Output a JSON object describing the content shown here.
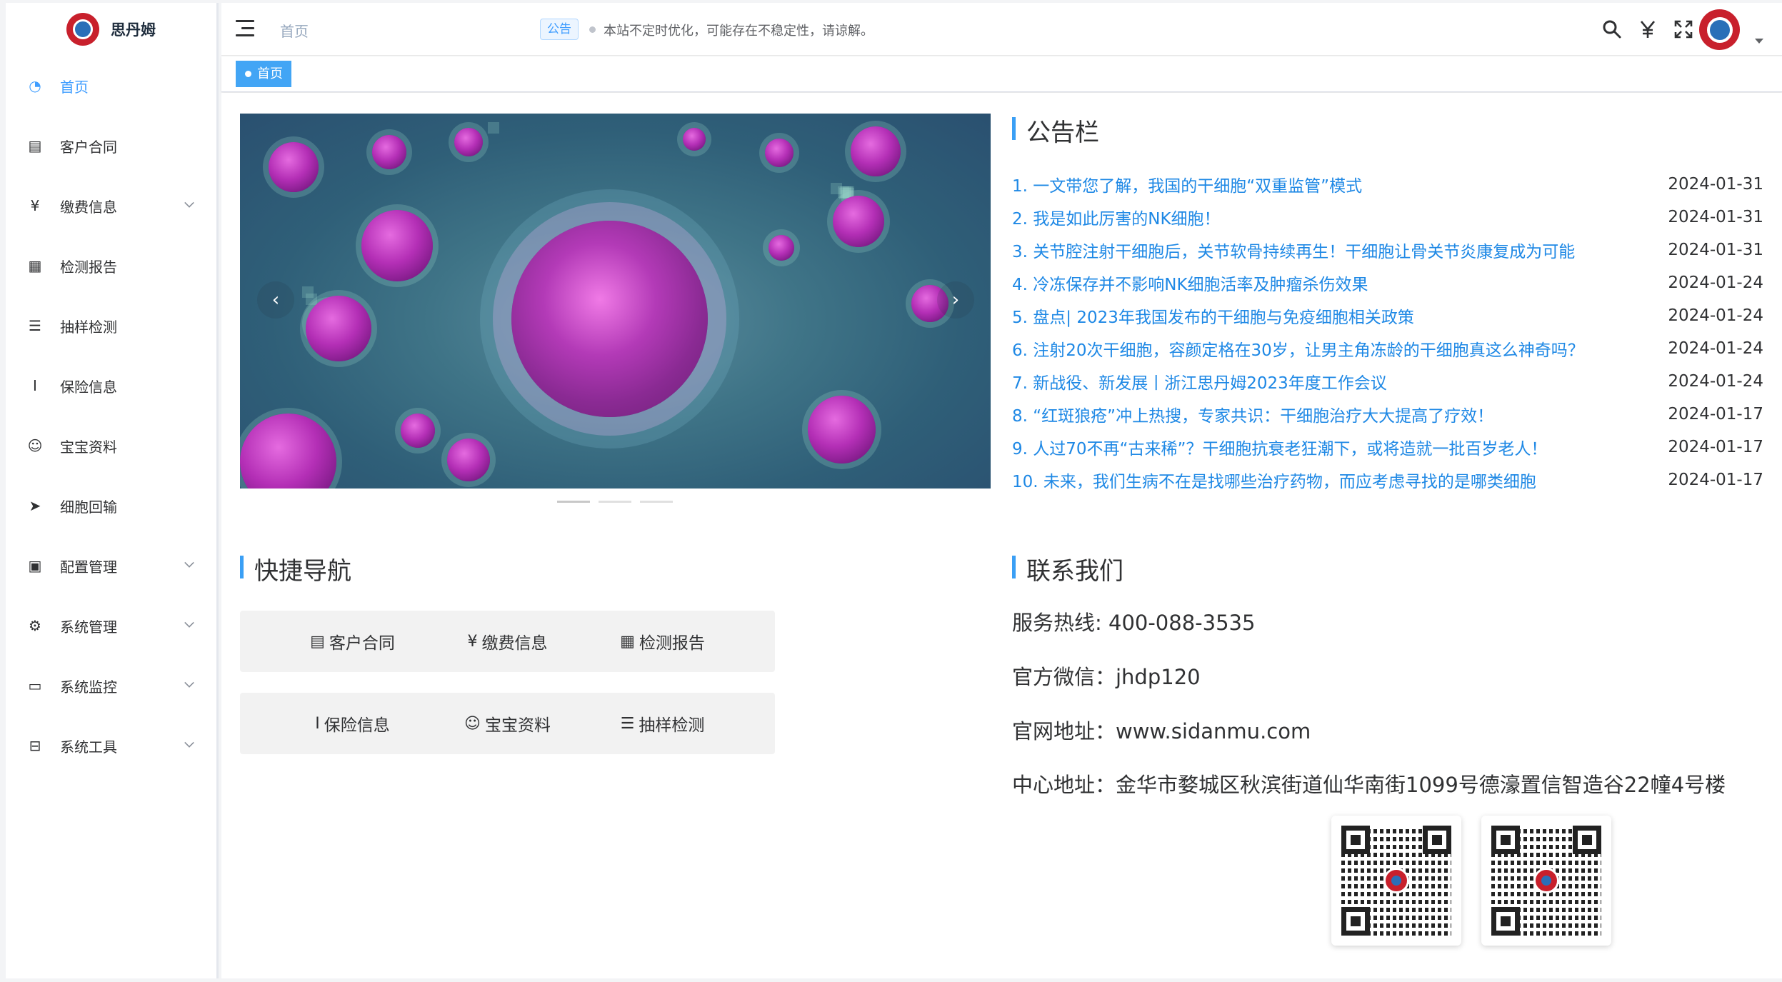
{
  "app": {
    "name": "思丹姆"
  },
  "sidebar": {
    "items": [
      {
        "label": "首页",
        "icon": "dashboard-icon",
        "glyph": "◔",
        "active": true,
        "expandable": false
      },
      {
        "label": "客户合同",
        "icon": "contract-icon",
        "glyph": "▤",
        "active": false,
        "expandable": false
      },
      {
        "label": "缴费信息",
        "icon": "yen-icon",
        "glyph": "¥",
        "active": false,
        "expandable": true
      },
      {
        "label": "检测报告",
        "icon": "report-icon",
        "glyph": "▦",
        "active": false,
        "expandable": false
      },
      {
        "label": "抽样检测",
        "icon": "list-icon",
        "glyph": "☰",
        "active": false,
        "expandable": false
      },
      {
        "label": "保险信息",
        "icon": "insurance-icon",
        "glyph": "I",
        "active": false,
        "expandable": false
      },
      {
        "label": "宝宝资料",
        "icon": "baby-icon",
        "glyph": "☺",
        "active": false,
        "expandable": false
      },
      {
        "label": "细胞回输",
        "icon": "send-icon",
        "glyph": "➤",
        "active": false,
        "expandable": false
      },
      {
        "label": "配置管理",
        "icon": "config-icon",
        "glyph": "▣",
        "active": false,
        "expandable": true
      },
      {
        "label": "系统管理",
        "icon": "gear-icon",
        "glyph": "⚙",
        "active": false,
        "expandable": true
      },
      {
        "label": "系统监控",
        "icon": "monitor-icon",
        "glyph": "▭",
        "active": false,
        "expandable": true
      },
      {
        "label": "系统工具",
        "icon": "tool-icon",
        "glyph": "⊟",
        "active": false,
        "expandable": true
      }
    ]
  },
  "header": {
    "breadcrumb": "首页",
    "notice_badge": "公告",
    "notice_text": "本站不定时优化，可能存在不稳定性，请谅解。",
    "icons": [
      "search-icon",
      "yen-icon",
      "fullscreen-icon"
    ]
  },
  "tags": {
    "active": "首页"
  },
  "announcements": {
    "title": "公告栏",
    "items": [
      {
        "title": "1. 一文带您了解，我国的干细胞“双重监管”模式",
        "date": "2024-01-31"
      },
      {
        "title": "2. 我是如此厉害的NK细胞！",
        "date": "2024-01-31"
      },
      {
        "title": "3. 关节腔注射干细胞后，关节软骨持续再生！干细胞让骨关节炎康复成为可能",
        "date": "2024-01-31"
      },
      {
        "title": "4. 冷冻保存并不影响NK细胞活率及肿瘤杀伤效果",
        "date": "2024-01-24"
      },
      {
        "title": "5. 盘点| 2023年我国发布的干细胞与免疫细胞相关政策",
        "date": "2024-01-24"
      },
      {
        "title": "6. 注射20次干细胞，容颜定格在30岁，让男主角冻龄的干细胞真这么神奇吗？",
        "date": "2024-01-24"
      },
      {
        "title": "7. 新战役、新发展丨浙江思丹姆2023年度工作会议",
        "date": "2024-01-24"
      },
      {
        "title": "8. “红斑狼疮”冲上热搜，专家共识：干细胞治疗大大提高了疗效！",
        "date": "2024-01-17"
      },
      {
        "title": "9. 人过70不再“古来稀”？干细胞抗衰老狂潮下，或将造就一批百岁老人！",
        "date": "2024-01-17"
      },
      {
        "title": "10. 未来，我们生病不在是找哪些治疗药物，而应考虑寻找的是哪类细胞",
        "date": "2024-01-17"
      }
    ]
  },
  "quicknav": {
    "title": "快捷导航",
    "buttons": [
      {
        "label": "客户合同",
        "icon": "contract-icon",
        "glyph": "▤"
      },
      {
        "label": "缴费信息",
        "icon": "yen-icon",
        "glyph": "¥"
      },
      {
        "label": "检测报告",
        "icon": "report-icon",
        "glyph": "▦"
      },
      {
        "label": "保险信息",
        "icon": "insurance-icon",
        "glyph": "I"
      },
      {
        "label": "宝宝资料",
        "icon": "baby-icon",
        "glyph": "☺"
      },
      {
        "label": "抽样检测",
        "icon": "list-icon",
        "glyph": "☰"
      }
    ]
  },
  "contact": {
    "title": "联系我们",
    "hotline": "服务热线: 400-088-3535",
    "wechat": "官方微信：jhdp120",
    "website": "官网地址：www.sidanmu.com",
    "address": "中心地址：金华市婺城区秋滨街道仙华南街1099号德濠置信智造谷22幢4号楼"
  },
  "carousel": {
    "slides": 3,
    "active": 0
  },
  "colors": {
    "accent": "#409eff",
    "link": "#1e88e5",
    "tag": "#42a5f5",
    "brand_red": "#c8202c"
  }
}
